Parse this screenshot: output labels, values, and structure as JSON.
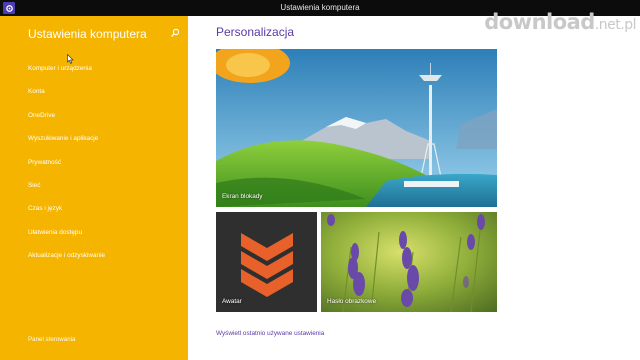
{
  "window": {
    "title": "Ustawienia komputera"
  },
  "sidebar": {
    "heading": "Ustawienia komputera",
    "items": [
      {
        "label": "Komputer i urządzenia"
      },
      {
        "label": "Konta"
      },
      {
        "label": "OneDrive"
      },
      {
        "label": "Wyszukiwanie i aplikacje"
      },
      {
        "label": "Prywatność"
      },
      {
        "label": "Sieć"
      },
      {
        "label": "Czas i język"
      },
      {
        "label": "Ułatwienia dostępu"
      },
      {
        "label": "Aktualizacje i odzyskiwanie"
      }
    ],
    "footer_link": "Panel sterowania"
  },
  "main": {
    "title": "Personalizacja",
    "tiles": {
      "lock_screen": "Ekran blokady",
      "avatar": "Awatar",
      "picture_password": "Hasło obrazkowe"
    },
    "recent_link": "Wyświetl ostatnio używane ustawienia"
  },
  "watermark": {
    "main": "download",
    "suffix": ".net.pl"
  },
  "colors": {
    "sidebar": "#f5b400",
    "accent": "#5b3aa8",
    "titlebar": "#0c0c0c",
    "avatar_tile": "#2f2f2f",
    "avatar_chevron": "#e8612a"
  }
}
